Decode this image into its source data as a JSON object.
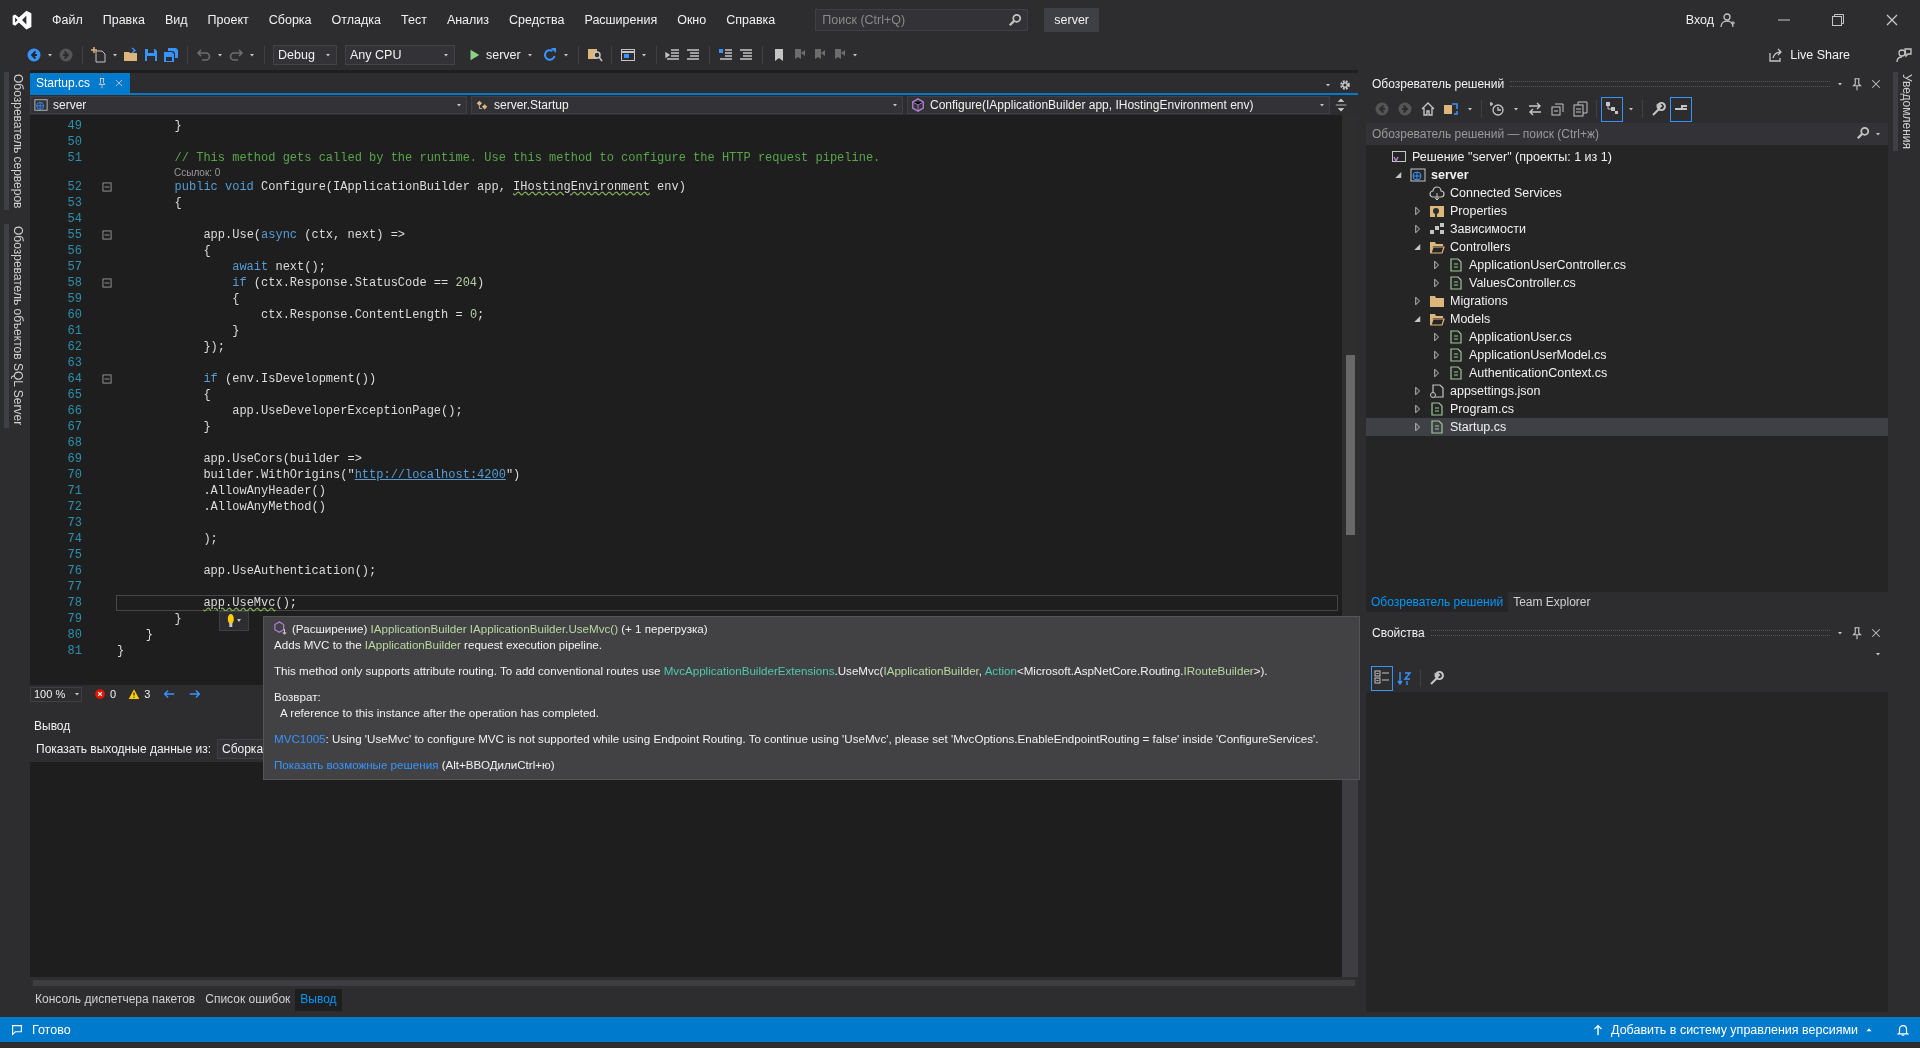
{
  "menu": [
    "Файл",
    "Правка",
    "Вид",
    "Проект",
    "Сборка",
    "Отладка",
    "Тест",
    "Анализ",
    "Средства",
    "Расширения",
    "Окно",
    "Справка"
  ],
  "search": {
    "placeholder": "Поиск (Ctrl+Q)"
  },
  "solution_badge": "server",
  "account": {
    "label": "Вход"
  },
  "toolbar": {
    "configuration": "Debug",
    "platform": "Any CPU",
    "start": "server",
    "live_share": "Live Share"
  },
  "left_tool_tabs": [
    "Обозреватель серверов",
    "Обозреватель объектов SQL Server"
  ],
  "right_tool_tabs": [
    "Уведомления"
  ],
  "editor": {
    "tabs": [
      {
        "label": "Startup.cs",
        "selected": true
      }
    ],
    "navigation": {
      "project": "server",
      "type": "server.Startup",
      "member": "Configure(IApplicationBuilder app, IHostingEnvironment env)"
    },
    "lines": [
      {
        "number": "49",
        "tokens": [
          {
            "kind": "plain",
            "text": "        }"
          }
        ]
      },
      {
        "number": "50"
      },
      {
        "number": "51",
        "tokens": [
          {
            "kind": "comment",
            "text": "        // This method gets called by the runtime. Use this method to configure the HTTP request pipeline."
          }
        ]
      },
      {
        "number": "52",
        "codelens": "Ссылок: 0",
        "foldable": true,
        "tokens": [
          {
            "kind": "keyword",
            "text": "        public void"
          },
          {
            "kind": "plain",
            "text": " Configure(IApplicationBuilder app, "
          },
          {
            "kind": "warning",
            "text": "IHostingEnvironment"
          },
          {
            "kind": "plain",
            "text": " env)"
          }
        ]
      },
      {
        "number": "53",
        "tokens": [
          {
            "kind": "plain",
            "text": "        {"
          }
        ]
      },
      {
        "number": "54"
      },
      {
        "number": "55",
        "foldable": true,
        "tokens": [
          {
            "kind": "plain",
            "text": "            app.Use("
          },
          {
            "kind": "keyword",
            "text": "async"
          },
          {
            "kind": "plain",
            "text": " (ctx, next) =>"
          }
        ]
      },
      {
        "number": "56",
        "tokens": [
          {
            "kind": "plain",
            "text": "            {"
          }
        ]
      },
      {
        "number": "57",
        "tokens": [
          {
            "kind": "keyword",
            "text": "                await"
          },
          {
            "kind": "plain",
            "text": " next();"
          }
        ]
      },
      {
        "number": "58",
        "foldable": true,
        "tokens": [
          {
            "kind": "keyword",
            "text": "                if"
          },
          {
            "kind": "plain",
            "text": " (ctx.Response.StatusCode == "
          },
          {
            "kind": "number",
            "text": "204"
          },
          {
            "kind": "plain",
            "text": ")"
          }
        ]
      },
      {
        "number": "59",
        "tokens": [
          {
            "kind": "plain",
            "text": "                {"
          }
        ]
      },
      {
        "number": "60",
        "tokens": [
          {
            "kind": "plain",
            "text": "                    ctx.Response.ContentLength = "
          },
          {
            "kind": "number",
            "text": "0"
          },
          {
            "kind": "plain",
            "text": ";"
          }
        ]
      },
      {
        "number": "61",
        "tokens": [
          {
            "kind": "plain",
            "text": "                }"
          }
        ]
      },
      {
        "number": "62",
        "tokens": [
          {
            "kind": "plain",
            "text": "            });"
          }
        ]
      },
      {
        "number": "63"
      },
      {
        "number": "64",
        "foldable": true,
        "tokens": [
          {
            "kind": "keyword",
            "text": "            if"
          },
          {
            "kind": "plain",
            "text": " (env.IsDevelopment())"
          }
        ]
      },
      {
        "number": "65",
        "tokens": [
          {
            "kind": "plain",
            "text": "            {"
          }
        ]
      },
      {
        "number": "66",
        "tokens": [
          {
            "kind": "plain",
            "text": "                app.UseDeveloperExceptionPage();"
          }
        ]
      },
      {
        "number": "67",
        "tokens": [
          {
            "kind": "plain",
            "text": "            }"
          }
        ]
      },
      {
        "number": "68"
      },
      {
        "number": "69",
        "tokens": [
          {
            "kind": "plain",
            "text": "            app.UseCors(builder =>"
          }
        ]
      },
      {
        "number": "70",
        "tokens": [
          {
            "kind": "plain",
            "text": "            builder.WithOrigins(\""
          },
          {
            "kind": "link",
            "text": "http://localhost:4200"
          },
          {
            "kind": "plain",
            "text": "\")"
          }
        ]
      },
      {
        "number": "71",
        "tokens": [
          {
            "kind": "plain",
            "text": "            .AllowAnyHeader()"
          }
        ]
      },
      {
        "number": "72",
        "tokens": [
          {
            "kind": "plain",
            "text": "            .AllowAnyMethod()"
          }
        ]
      },
      {
        "number": "73"
      },
      {
        "number": "74",
        "tokens": [
          {
            "kind": "plain",
            "text": "            );"
          }
        ]
      },
      {
        "number": "75"
      },
      {
        "number": "76",
        "tokens": [
          {
            "kind": "plain",
            "text": "            app.UseAuthentication();"
          }
        ]
      },
      {
        "number": "77"
      },
      {
        "number": "78",
        "current": true,
        "tokens": [
          {
            "kind": "warning",
            "text": "            app.UseMvc"
          },
          {
            "kind": "plain",
            "text": "();"
          }
        ]
      },
      {
        "number": "79",
        "tokens": [
          {
            "kind": "plain",
            "text": "        }"
          }
        ]
      },
      {
        "number": "80",
        "tokens": [
          {
            "kind": "plain",
            "text": "    }"
          }
        ]
      },
      {
        "number": "81",
        "tokens": [
          {
            "kind": "plain",
            "text": "}"
          }
        ]
      }
    ],
    "zoom": "100 %",
    "errors": "0",
    "warnings": "3"
  },
  "quick_info": {
    "signature": [
      {
        "kind": "text",
        "text": "(Расширение) "
      },
      {
        "kind": "interface",
        "text": "IApplicationBuilder IApplicationBuilder.UseMvc()"
      },
      {
        "kind": "text",
        "text": " (+ 1 перегрузка)"
      }
    ],
    "summary": [
      {
        "kind": "text",
        "text": "Adds MVC to the "
      },
      {
        "kind": "interface",
        "text": "IApplicationBuilder"
      },
      {
        "kind": "text",
        "text": " request execution pipeline."
      }
    ],
    "remarks": [
      {
        "kind": "text",
        "text": "This method only supports attribute routing. To add conventional routes use "
      },
      {
        "kind": "class",
        "text": "MvcApplicationBuilderExtensions"
      },
      {
        "kind": "text",
        "text": ".UseMvc("
      },
      {
        "kind": "interface",
        "text": "IApplicationBuilder"
      },
      {
        "kind": "text",
        "text": ", "
      },
      {
        "kind": "class",
        "text": "Action"
      },
      {
        "kind": "text",
        "text": "<Microsoft.AspNetCore.Routing."
      },
      {
        "kind": "interface",
        "text": "IRouteBuilder"
      },
      {
        "kind": "text",
        "text": ">)."
      }
    ],
    "returns_heading": "Возврат:",
    "returns": "A reference to this instance after the operation has completed.",
    "diagnostic": [
      {
        "kind": "link",
        "text": "MVC1005"
      },
      {
        "kind": "text",
        "text": ": Using 'UseMvc' to configure MVC is not supported while using Endpoint Routing. To continue using 'UseMvc', please set 'MvcOptions.EnableEndpointRouting = false' inside 'ConfigureServices'."
      }
    ],
    "fix": [
      {
        "kind": "link",
        "text": "Показать возможные решения"
      },
      {
        "kind": "text",
        "text": " (Alt+ВВОДилиCtrl+ю)"
      }
    ]
  },
  "output": {
    "title": "Вывод",
    "source_label": "Показать выходные данные из:",
    "source": "Сборка",
    "tabs": [
      {
        "label": "Консоль диспетчера пакетов",
        "selected": false
      },
      {
        "label": "Список ошибок",
        "selected": false
      },
      {
        "label": "Вывод",
        "selected": true
      }
    ]
  },
  "solution_explorer": {
    "title": "Обозреватель решений",
    "search": {
      "placeholder": "Обозреватель решений — поиск (Ctrl+ж)"
    },
    "tree": [
      {
        "label": "Решение \"server\" (проекты: 1 из 1)",
        "kind": "solution",
        "selected": false,
        "children": [
          {
            "label": "server",
            "kind": "project",
            "expanded": true,
            "selected": false,
            "children": [
              {
                "label": "Connected Services",
                "kind": "connected",
                "selected": false
              },
              {
                "label": "Properties",
                "kind": "properties",
                "expanded": false,
                "selected": false
              },
              {
                "label": "Зависимости",
                "kind": "dependencies",
                "expanded": false,
                "selected": false
              },
              {
                "label": "Controllers",
                "kind": "folder",
                "expanded": true,
                "selected": false,
                "children": [
                  {
                    "label": "ApplicationUserController.cs",
                    "kind": "csharp",
                    "expanded": false,
                    "selected": false
                  },
                  {
                    "label": "ValuesController.cs",
                    "kind": "csharp",
                    "expanded": false,
                    "selected": false
                  }
                ]
              },
              {
                "label": "Migrations",
                "kind": "folder",
                "expanded": false,
                "selected": false
              },
              {
                "label": "Models",
                "kind": "folder",
                "expanded": true,
                "selected": false,
                "children": [
                  {
                    "label": "ApplicationUser.cs",
                    "kind": "csharp",
                    "expanded": false,
                    "selected": false
                  },
                  {
                    "label": "ApplicationUserModel.cs",
                    "kind": "csharp",
                    "expanded": false,
                    "selected": false
                  },
                  {
                    "label": "AuthenticationContext.cs",
                    "kind": "csharp",
                    "expanded": false,
                    "selected": false
                  }
                ]
              },
              {
                "label": "appsettings.json",
                "kind": "json",
                "expanded": false,
                "selected": false
              },
              {
                "label": "Program.cs",
                "kind": "csharp",
                "expanded": false,
                "selected": false
              },
              {
                "label": "Startup.cs",
                "kind": "csharp",
                "expanded": false,
                "selected": true
              }
            ]
          }
        ]
      }
    ],
    "tabs": [
      {
        "label": "Обозреватель решений",
        "selected": true
      },
      {
        "label": "Team Explorer",
        "selected": false
      }
    ]
  },
  "properties": {
    "title": "Свойства"
  },
  "status_bar": {
    "text": "Готово",
    "source_control": "Добавить в систему управления версиями"
  }
}
